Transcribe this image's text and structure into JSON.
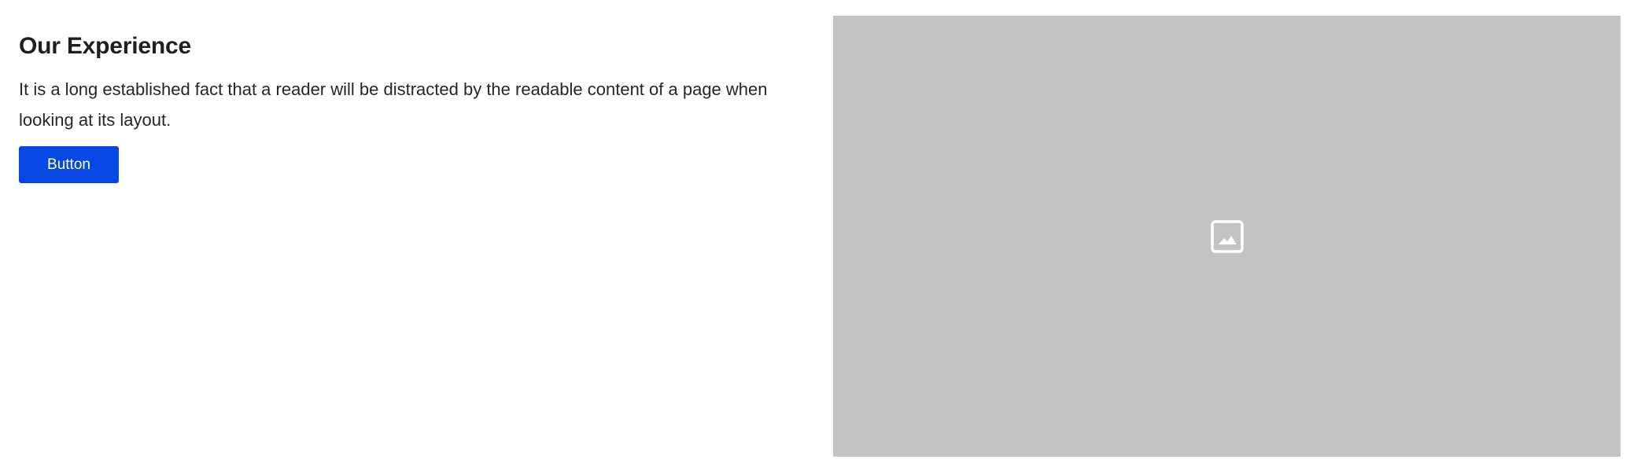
{
  "section": {
    "heading": "Our Experience",
    "description": "It is a long established fact that a reader will be distracted by the readable content of a page when looking at its layout.",
    "button_label": "Button"
  },
  "media": {
    "icon": "image-icon",
    "background_color": "#c3c3c3",
    "icon_color": "#ffffff"
  },
  "colors": {
    "accent": "#0847e3",
    "text": "#262626"
  }
}
